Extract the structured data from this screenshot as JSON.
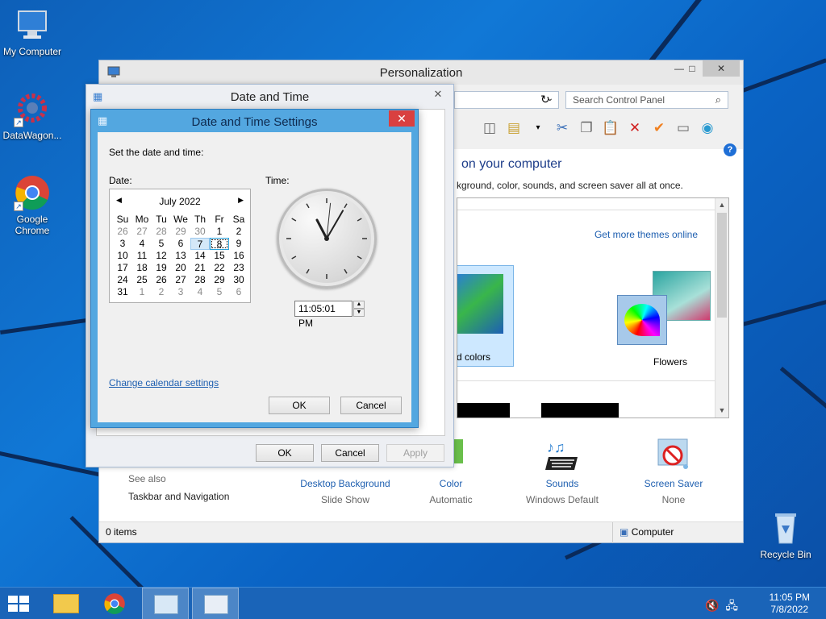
{
  "desktop": {
    "icons": [
      {
        "label": "My Computer"
      },
      {
        "label": "DataWagon..."
      },
      {
        "label": "Google Chrome"
      },
      {
        "label": "Recycle Bin"
      }
    ]
  },
  "personalization": {
    "title": "Personalization",
    "search_placeholder": "Search Control Panel",
    "heading": "on your computer",
    "subheading": "kground, color, sounds, and screen saver all at once.",
    "themes_link": "Get more themes online",
    "themes": [
      {
        "label": "d colors",
        "selected": true
      },
      {
        "label": "Flowers",
        "selected": false
      }
    ],
    "see_also_label": "See also",
    "see_also_links": [
      "Taskbar and Navigation"
    ],
    "bottom_items": [
      {
        "name": "Desktop Background",
        "value": "Slide Show",
        "icon": "desktop-background-icon"
      },
      {
        "name": "Color",
        "value": "Automatic",
        "icon": "color-icon"
      },
      {
        "name": "Sounds",
        "value": "Windows Default",
        "icon": "sounds-icon"
      },
      {
        "name": "Screen Saver",
        "value": "None",
        "icon": "screen-saver-icon"
      }
    ],
    "status_items": "0 items",
    "status_location": "Computer"
  },
  "date_time_dialog": {
    "title": "Date and Time",
    "buttons": {
      "ok": "OK",
      "cancel": "Cancel",
      "apply": "Apply"
    }
  },
  "date_time_settings": {
    "title": "Date and Time Settings",
    "instruction": "Set the date and time:",
    "date_label": "Date:",
    "time_label": "Time:",
    "calendar": {
      "month_year": "July 2022",
      "weekdays": [
        "Su",
        "Mo",
        "Tu",
        "We",
        "Th",
        "Fr",
        "Sa"
      ],
      "days": [
        [
          "26",
          "27",
          "28",
          "29",
          "30",
          "1",
          "2"
        ],
        [
          "3",
          "4",
          "5",
          "6",
          "7",
          "8",
          "9"
        ],
        [
          "10",
          "11",
          "12",
          "13",
          "14",
          "15",
          "16"
        ],
        [
          "17",
          "18",
          "19",
          "20",
          "21",
          "22",
          "23"
        ],
        [
          "24",
          "25",
          "26",
          "27",
          "28",
          "29",
          "30"
        ],
        [
          "31",
          "1",
          "2",
          "3",
          "4",
          "5",
          "6"
        ]
      ],
      "today": "7",
      "selected": "8"
    },
    "clock": {
      "hour": 11,
      "minute": 5,
      "second": 1
    },
    "time_value": "11:05:01 PM",
    "change_calendar_link": "Change calendar settings",
    "buttons": {
      "ok": "OK",
      "cancel": "Cancel"
    }
  },
  "taskbar": {
    "time": "11:05 PM",
    "date": "7/8/2022"
  }
}
